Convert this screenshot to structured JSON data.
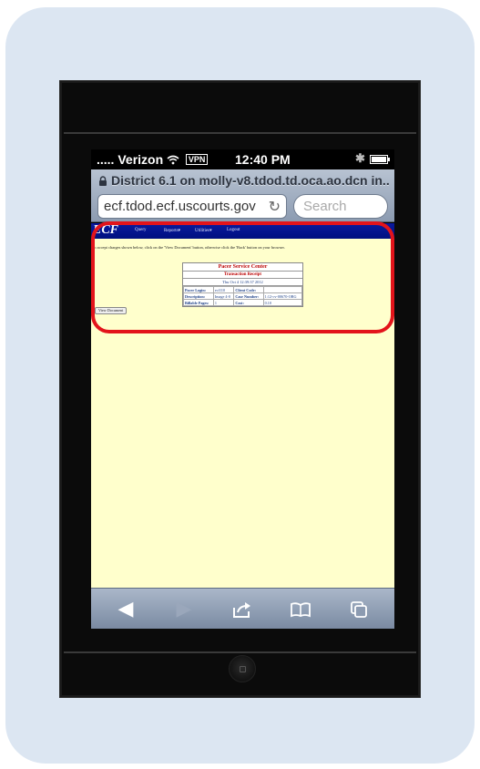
{
  "status_bar": {
    "signal": "..... Verizon",
    "wifi_icon": "wifi-icon",
    "vpn": "VPN",
    "time": "12:40 PM",
    "bluetooth": "✱",
    "battery_level": 0.9
  },
  "safari": {
    "page_title": "District 6.1 on molly-v8.tdod.td.oca.ao.dcn in...",
    "url": "ecf.tdod.ecf.uscourts.gov",
    "reload_glyph": "↻",
    "search_placeholder": "Search"
  },
  "ecf": {
    "logo": "ECF",
    "menu": [
      "Query",
      "Reports▾",
      "Utilities▾",
      "Logout"
    ],
    "notice": "To accept charges shown below, click on the 'View Document' button, otherwise click the 'Back' button on your browser.",
    "receipt": {
      "title": "Pacer Service Center",
      "subtitle": "Transaction Receipt",
      "date": "Thu Oct 4 12:39:37 2012",
      "rows": [
        [
          "Pacer Login:",
          "ecf110",
          "Client Code:",
          ""
        ],
        [
          "Description:",
          "Image 4-0",
          "Case Number:",
          "1:12-cv-00670-ORG"
        ],
        [
          "Billable Pages:",
          "1",
          "Cost:",
          "0.10"
        ]
      ]
    },
    "view_button": "View Document"
  },
  "toolbar": {
    "back": "◀",
    "forward": "▶",
    "share": "⇪",
    "bookmarks": "☷",
    "pages": "⧉"
  },
  "colors": {
    "highlight": "#e3141b",
    "ecf_nav": "#0a1a9e",
    "page_bg": "#ffffcc",
    "card_bg": "#dce6f2"
  }
}
